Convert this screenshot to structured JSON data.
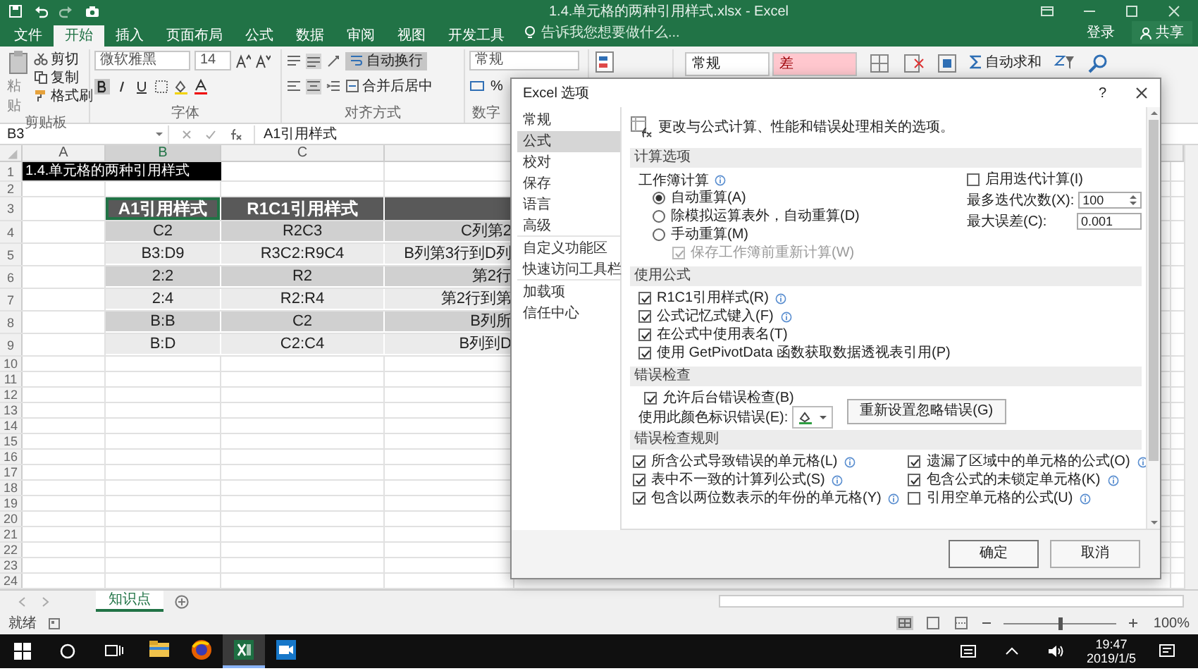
{
  "window": {
    "title": "1.4.单元格的两种引用样式.xlsx - Excel",
    "sign_in": "登录",
    "share": "共享"
  },
  "ribbon_tabs": [
    {
      "label": "文件",
      "selected": false
    },
    {
      "label": "开始",
      "selected": true
    },
    {
      "label": "插入",
      "selected": false
    },
    {
      "label": "页面布局",
      "selected": false
    },
    {
      "label": "公式",
      "selected": false
    },
    {
      "label": "数据",
      "selected": false
    },
    {
      "label": "审阅",
      "selected": false
    },
    {
      "label": "视图",
      "selected": false
    },
    {
      "label": "开发工具",
      "selected": false
    }
  ],
  "tell_me": "告诉我您想要做什么...",
  "ribbon": {
    "clipboard": {
      "paste": "粘贴",
      "cut": "剪切",
      "copy": "复制",
      "format_painter": "格式刷",
      "label": "剪贴板"
    },
    "font": {
      "name": "微软雅黑",
      "size": "14",
      "label": "字体"
    },
    "alignment": {
      "wrap_text": "自动换行",
      "wrap_on": true,
      "merge": "合并后居中",
      "label": "对齐方式"
    },
    "number": {
      "format": "常规",
      "percent": "%",
      "label": "数字"
    },
    "styles": [
      {
        "label": "常规",
        "kind": "normal"
      },
      {
        "label": "差",
        "kind": "bad"
      }
    ],
    "editing": {
      "autosum": "自动求和"
    }
  },
  "name_box": "B3",
  "formula": "A1引用样式",
  "sheet": {
    "columns": [
      "A",
      "B",
      "C"
    ],
    "row_numbers": [
      "1",
      "2",
      "3",
      "4",
      "5",
      "6",
      "7",
      "8",
      "9",
      "10",
      "11",
      "12",
      "13",
      "14",
      "15",
      "16",
      "17",
      "18",
      "19",
      "20",
      "21",
      "22",
      "23",
      "24"
    ],
    "title_cell": "1.4.单元格的两种引用样式",
    "header": [
      {
        "text": "A1引用样式",
        "selected": true
      },
      {
        "text": "R1C1引用样式",
        "selected": false
      }
    ],
    "rows": [
      [
        "",
        "C2",
        "R2C3",
        "C列第2"
      ],
      [
        "",
        "B3:D9",
        "R3C2:R9C4",
        "B列第3行到D列"
      ],
      [
        "",
        "2:2",
        "R2",
        "第2行"
      ],
      [
        "",
        "2:4",
        "R2:R4",
        "第2行到第"
      ],
      [
        "",
        "B:B",
        "C2",
        "B列所"
      ],
      [
        "",
        "B:D",
        "C2:C4",
        "B列到D"
      ]
    ]
  },
  "sheet_tabs": [
    {
      "label": "知识点",
      "selected": true
    }
  ],
  "status": "就绪",
  "zoom": {
    "label": "100%",
    "level": 0.5
  },
  "taskbar": {
    "apps": [
      {
        "kind": "folder",
        "selected": false
      },
      {
        "kind": "browser",
        "selected": false
      },
      {
        "kind": "spreadsheet",
        "selected": true
      },
      {
        "kind": "video",
        "selected": false
      }
    ],
    "time": "19:47",
    "date": "2019/1/5"
  },
  "dialog": {
    "title": "Excel 选项",
    "help": "?",
    "nav": [
      {
        "label": "常规",
        "selected": false
      },
      {
        "label": "公式",
        "selected": true
      },
      {
        "label": "校对",
        "selected": false
      },
      {
        "label": "保存",
        "selected": false
      },
      {
        "label": "语言",
        "selected": false
      },
      {
        "label": "高级",
        "selected": false
      },
      {
        "label": "自定义功能区",
        "selected": false
      },
      {
        "label": "快速访问工具栏",
        "selected": false
      },
      {
        "label": "加载项",
        "selected": false
      },
      {
        "label": "信任中心",
        "selected": false
      }
    ],
    "intro": "更改与公式计算、性能和错误处理相关的选项。",
    "sections": [
      {
        "kind": "calculation",
        "title": "计算选项",
        "workbook_label": "工作簿计算",
        "modes": [
          {
            "label": "自动重算(A)",
            "selected": true
          },
          {
            "label": "除模拟运算表外，自动重算(D)",
            "selected": false
          },
          {
            "label": "手动重算(M)",
            "selected": false
          }
        ],
        "recalc_before_save": {
          "label": "保存工作簿前重新计算(W)",
          "checked": true,
          "disabled": true
        },
        "iterative": {
          "label": "启用迭代计算(I)",
          "checked": false
        },
        "max_iterations": {
          "label": "最多迭代次数(X):",
          "value": "100"
        },
        "max_change": {
          "label": "最大误差(C):",
          "value": "0.001"
        }
      },
      {
        "kind": "checklist",
        "title": "使用公式",
        "items": [
          {
            "label": "R1C1引用样式(R)",
            "checked": true,
            "info": true
          },
          {
            "label": "公式记忆式键入(F)",
            "checked": true,
            "info": true
          },
          {
            "label": "在公式中使用表名(T)",
            "checked": true,
            "info": false
          },
          {
            "label": "使用 GetPivotData 函数获取数据透视表引用(P)",
            "checked": true,
            "info": false
          }
        ]
      },
      {
        "kind": "error_checking",
        "title": "错误检查",
        "background": {
          "label": "允许后台错误检查(B)",
          "checked": true
        },
        "color_label": "使用此颜色标识错误(E):",
        "reset": "重新设置忽略错误(G)"
      },
      {
        "kind": "rules",
        "title": "错误检查规则",
        "items": [
          {
            "label": "所含公式导致错误的单元格(L)",
            "checked": true,
            "info": true
          },
          {
            "label": "遗漏了区域中的单元格的公式(O)",
            "checked": true,
            "info": true
          },
          {
            "label": "表中不一致的计算列公式(S)",
            "checked": true,
            "info": true
          },
          {
            "label": "包含公式的未锁定单元格(K)",
            "checked": true,
            "info": true
          },
          {
            "label": "包含以两位数表示的年份的单元格(Y)",
            "checked": true,
            "info": true
          },
          {
            "label": "引用空单元格的公式(U)",
            "checked": false,
            "info": true
          }
        ]
      }
    ],
    "ok": "确定",
    "cancel": "取消"
  }
}
